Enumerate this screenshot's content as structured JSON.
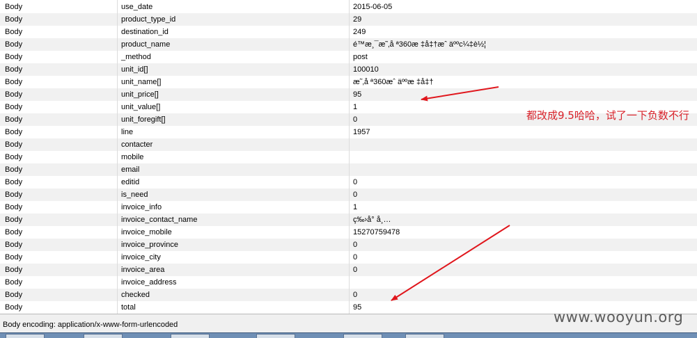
{
  "rows": [
    {
      "type": "Body",
      "name": "use_date",
      "value": "2015-06-05"
    },
    {
      "type": "Body",
      "name": "product_type_id",
      "value": "29"
    },
    {
      "type": "Body",
      "name": "destination_id",
      "value": "249"
    },
    {
      "type": "Body",
      "name": "product_name",
      "value": "é™æ¸¯æ˜‚å ª360æ ‡å‡†æˆ äººc¼‡è½¦"
    },
    {
      "type": "Body",
      "name": "_method",
      "value": "post"
    },
    {
      "type": "Body",
      "name": "unit_id[]",
      "value": "100010"
    },
    {
      "type": "Body",
      "name": "unit_name[]",
      "value": "æ˜‚å ª360æˆ äººæ ‡å‡†"
    },
    {
      "type": "Body",
      "name": "unit_price[]",
      "value": "95"
    },
    {
      "type": "Body",
      "name": "unit_value[]",
      "value": "1"
    },
    {
      "type": "Body",
      "name": "unit_foregift[]",
      "value": "0"
    },
    {
      "type": "Body",
      "name": "line",
      "value": "1957"
    },
    {
      "type": "Body",
      "name": "contacter",
      "value": ""
    },
    {
      "type": "Body",
      "name": "mobile",
      "value": ""
    },
    {
      "type": "Body",
      "name": "email",
      "value": ""
    },
    {
      "type": "Body",
      "name": "editid",
      "value": "0"
    },
    {
      "type": "Body",
      "name": "is_need",
      "value": "0"
    },
    {
      "type": "Body",
      "name": "invoice_info",
      "value": "1"
    },
    {
      "type": "Body",
      "name": "invoice_contact_name",
      "value": "ç‰›å° å¸…"
    },
    {
      "type": "Body",
      "name": "invoice_mobile",
      "value": "15270759478"
    },
    {
      "type": "Body",
      "name": "invoice_province",
      "value": "0"
    },
    {
      "type": "Body",
      "name": "invoice_city",
      "value": "0"
    },
    {
      "type": "Body",
      "name": "invoice_area",
      "value": "0"
    },
    {
      "type": "Body",
      "name": "invoice_address",
      "value": ""
    },
    {
      "type": "Body",
      "name": "checked",
      "value": "0"
    },
    {
      "type": "Body",
      "name": "total",
      "value": "95"
    }
  ],
  "status_bar": {
    "encoding": "Body encoding: application/x-www-form-urlencoded"
  },
  "annotation": {
    "note": "都改成9.5哈哈，试了一下负数不行",
    "color": "#d8222a"
  },
  "watermark": "www.wooyun.org",
  "colors": {
    "alt_row": "#f1f1f1",
    "arrow": "#e0161c"
  }
}
